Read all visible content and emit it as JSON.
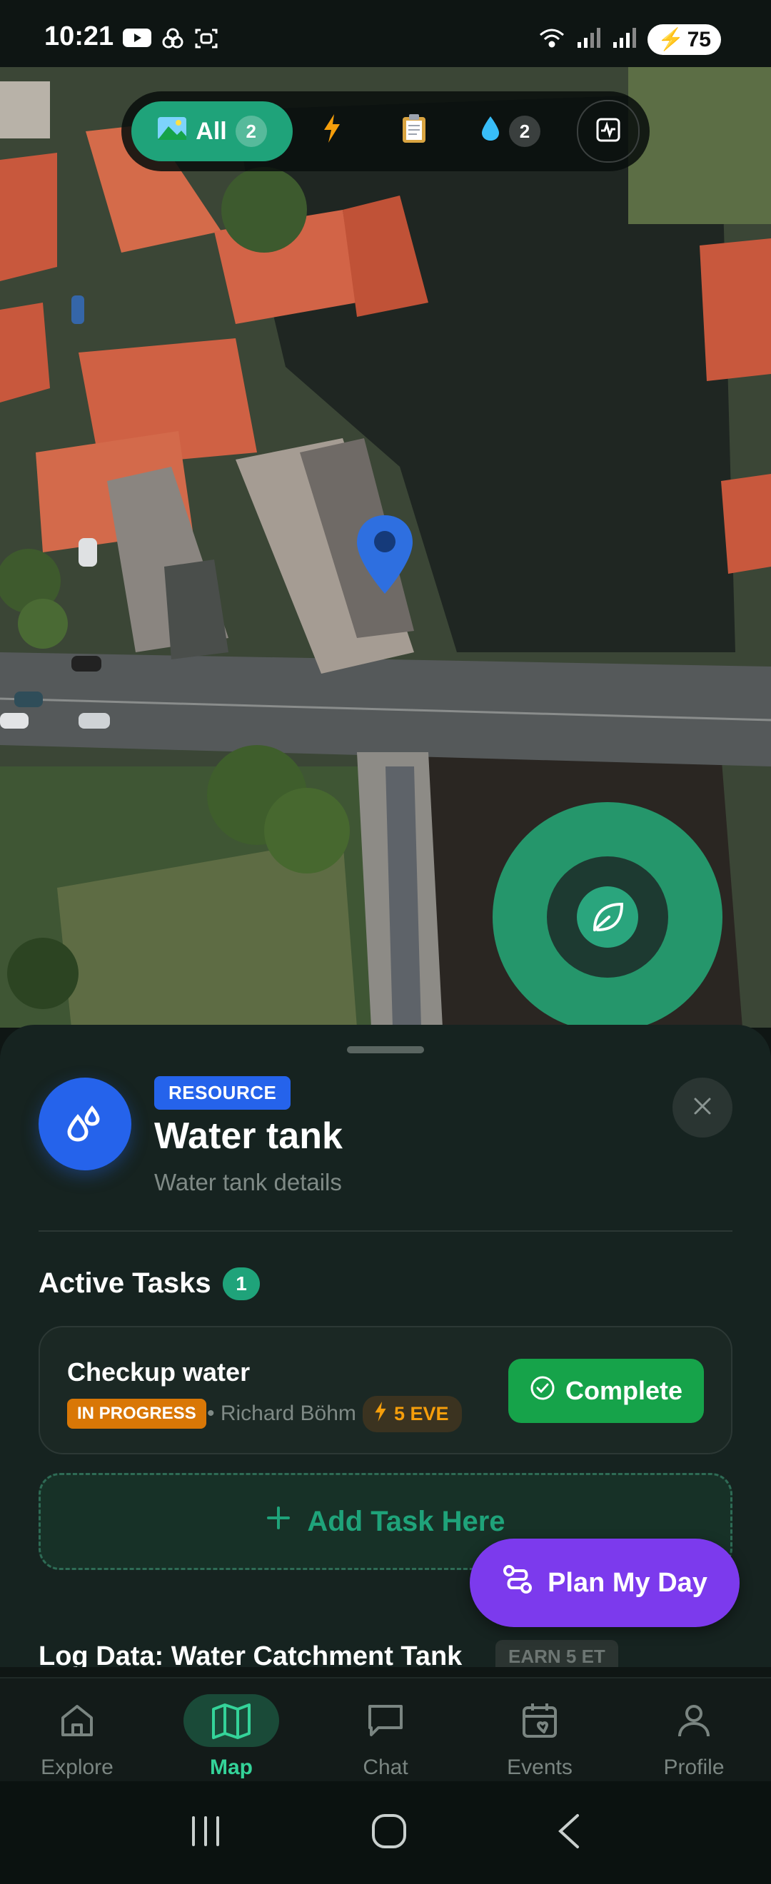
{
  "status_bar": {
    "time": "10:21",
    "battery": "75"
  },
  "filters": {
    "all_label": "All",
    "all_count": "2",
    "water_count": "2"
  },
  "resource": {
    "badge": "RESOURCE",
    "title": "Water tank",
    "subtitle": "Water tank details"
  },
  "tasks": {
    "section_title": "Active Tasks",
    "count": "1",
    "items": [
      {
        "title": "Checkup water",
        "status": "IN PROGRESS",
        "assignee": "• Richard Böhm",
        "reward": "5 EVE",
        "action_label": "Complete"
      }
    ],
    "add_label": "Add Task Here"
  },
  "log": {
    "title": "Log Data: Water Catchment Tank",
    "earn_badge": "EARN 5 ET"
  },
  "fab": {
    "plan_label": "Plan My Day"
  },
  "nav": {
    "items": [
      {
        "label": "Explore",
        "icon": "home-icon"
      },
      {
        "label": "Map",
        "icon": "map-icon"
      },
      {
        "label": "Chat",
        "icon": "chat-icon"
      },
      {
        "label": "Events",
        "icon": "calendar-heart-icon"
      },
      {
        "label": "Profile",
        "icon": "user-icon"
      }
    ],
    "active": "Map"
  },
  "colors": {
    "accent_green": "#1fa37a",
    "resource_blue": "#2563eb",
    "complete_green": "#16a34a",
    "in_progress_orange": "#d97706",
    "plan_purple": "#7c3aed",
    "nav_active": "#34d399"
  }
}
